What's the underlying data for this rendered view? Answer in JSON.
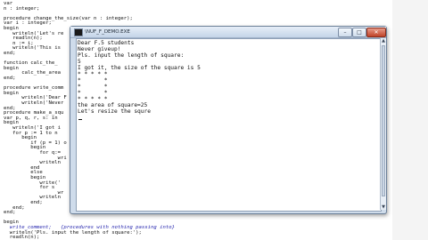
{
  "editor": {
    "lines": [
      {
        "text": "var",
        "kind": "normal"
      },
      {
        "text": "n : integer;",
        "kind": "normal"
      },
      {
        "text": "",
        "kind": "normal"
      },
      {
        "text": "procedure change_the_size(var n : integer);",
        "kind": "normal"
      },
      {
        "text": "var i : integer;",
        "kind": "normal"
      },
      {
        "text": "begin",
        "kind": "normal"
      },
      {
        "text": "   writeln('Let's re",
        "kind": "normal"
      },
      {
        "text": "   readln(n);",
        "kind": "normal"
      },
      {
        "text": "   n := i;",
        "kind": "normal"
      },
      {
        "text": "   writeln('This is",
        "kind": "normal"
      },
      {
        "text": "end;",
        "kind": "normal"
      },
      {
        "text": "",
        "kind": "normal"
      },
      {
        "text": "function calc_the_",
        "kind": "normal"
      },
      {
        "text": "begin",
        "kind": "normal"
      },
      {
        "text": "      calc_the_area",
        "kind": "normal"
      },
      {
        "text": "end;",
        "kind": "normal"
      },
      {
        "text": "",
        "kind": "normal"
      },
      {
        "text": "procedure write_comm",
        "kind": "normal"
      },
      {
        "text": "begin",
        "kind": "normal"
      },
      {
        "text": "      writeln('Dear F",
        "kind": "normal"
      },
      {
        "text": "      writeln('Never",
        "kind": "normal"
      },
      {
        "text": "end;",
        "kind": "normal"
      },
      {
        "text": "procedure make_a_squ",
        "kind": "normal"
      },
      {
        "text": "var p, q, r, s: in",
        "kind": "normal"
      },
      {
        "text": "begin",
        "kind": "normal"
      },
      {
        "text": "   writeln('I got i",
        "kind": "normal"
      },
      {
        "text": "   for p := 1 to n",
        "kind": "normal"
      },
      {
        "text": "      begin",
        "kind": "normal"
      },
      {
        "text": "         if (p = 1) o",
        "kind": "normal"
      },
      {
        "text": "         begin",
        "kind": "normal"
      },
      {
        "text": "            for q:=",
        "kind": "normal"
      },
      {
        "text": "                  wri",
        "kind": "normal"
      },
      {
        "text": "            writeln",
        "kind": "normal"
      },
      {
        "text": "         end",
        "kind": "normal"
      },
      {
        "text": "         else",
        "kind": "normal"
      },
      {
        "text": "         begin",
        "kind": "normal"
      },
      {
        "text": "            write('",
        "kind": "normal"
      },
      {
        "text": "            for s",
        "kind": "normal"
      },
      {
        "text": "                  wr",
        "kind": "normal"
      },
      {
        "text": "            writeln",
        "kind": "normal"
      },
      {
        "text": "         end;",
        "kind": "normal"
      },
      {
        "text": "   end;",
        "kind": "normal"
      },
      {
        "text": "end;",
        "kind": "normal"
      },
      {
        "text": "",
        "kind": "normal"
      },
      {
        "text": "begin",
        "kind": "normal"
      },
      {
        "text": "  write_comment;   {procedures with nothing passing into}",
        "kind": "comment"
      },
      {
        "text": "  writeln('Pls. input the length of square:');",
        "kind": "normal"
      },
      {
        "text": "  readln(n);",
        "kind": "normal"
      }
    ]
  },
  "console": {
    "title": "\\NUF_F_DEMO.EXE",
    "buttons": {
      "minimize": "–",
      "maximize": "□",
      "close": "✕"
    },
    "lines": [
      "Dear F.5 students",
      "Never giveup!",
      "Pls. input the length of square:",
      "5",
      "I got it, the size of the square is 5",
      "* * * * *",
      "*       *",
      "*       *",
      "*       *",
      "* * * * *",
      "the area of square=25",
      "Let's resize the squre"
    ]
  },
  "colors": {
    "window_frame": "#cfdceb",
    "close_button": "#c0442a",
    "console_bg": "#ffffff"
  }
}
